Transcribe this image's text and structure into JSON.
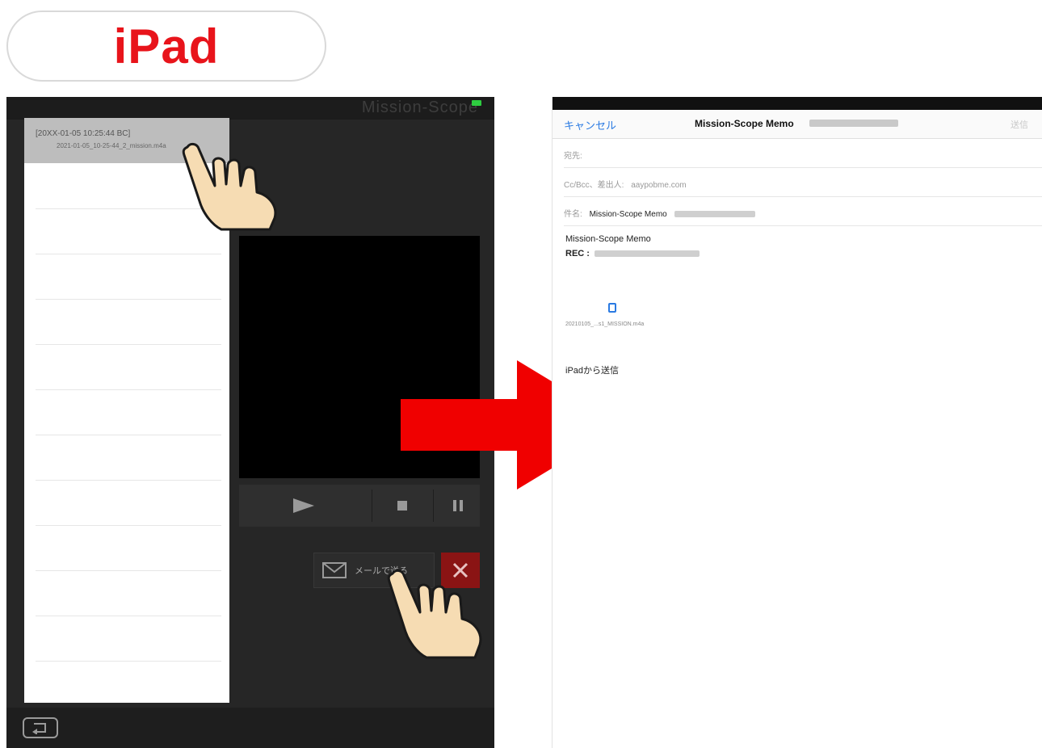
{
  "header": {
    "title": "iPad"
  },
  "app": {
    "title": "Mission-Scope",
    "selected_file": {
      "name": "[20XX-01-05 10:25:44 BC]",
      "sub": "2021-01-05_10-25-44_2_mission.m4a"
    },
    "controls": {
      "play_icon": "play-icon",
      "stop_icon": "stop-icon",
      "pause_icon": "pause-icon"
    },
    "mail_button_label": "メールで送る",
    "close_icon": "close-icon",
    "back_icon": "back-icon"
  },
  "mail": {
    "cancel_label": "キャンセル",
    "compose_title": "Mission-Scope Memo",
    "send_label": "送信",
    "to_label": "宛先:",
    "cc_label": "Cc/Bcc、差出人:",
    "cc_value": "aaypobme.com",
    "subject_label": "件名:",
    "subject_value": "Mission-Scope Memo",
    "body_line1": "Mission-Scope Memo",
    "body_line2": "REC :",
    "attachment_name": "20210105_...s1_MISSION.m4a",
    "signature": "iPadから送信"
  },
  "colors": {
    "accent_red": "#e8141b",
    "ios_blue": "#2a7ae2",
    "arrow_red": "#f00000"
  }
}
